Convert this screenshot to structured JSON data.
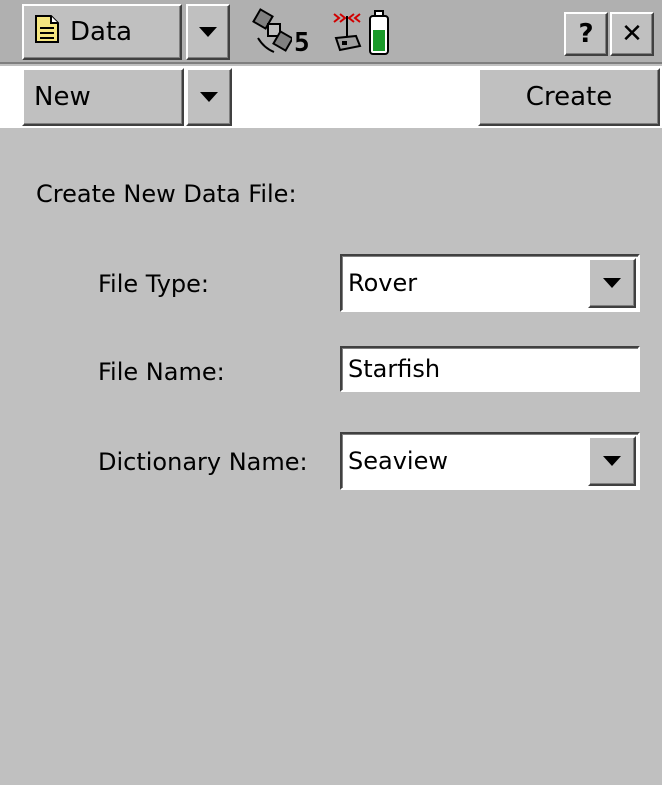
{
  "topbar": {
    "section_label": "Data",
    "satellite_count": "5",
    "help_label": "?",
    "close_label": "✕"
  },
  "commandbar": {
    "mode_label": "New",
    "create_label": "Create"
  },
  "form": {
    "heading": "Create New Data File:",
    "file_type_label": "File Type:",
    "file_type_value": "Rover",
    "file_name_label": "File Name:",
    "file_name_value": "Starfish",
    "dictionary_label": "Dictionary Name:",
    "dictionary_value": "Seaview"
  },
  "icons": {
    "section": "document-icon",
    "satellite": "satellite-icon",
    "radio": "radio-signal-icon",
    "battery": "battery-icon",
    "dropdown": "chevron-down-icon"
  },
  "colors": {
    "background": "#c0c0c0",
    "battery_fill": "#1a9a2a",
    "signal": "#d00000",
    "doc_icon": "#f5e680"
  }
}
